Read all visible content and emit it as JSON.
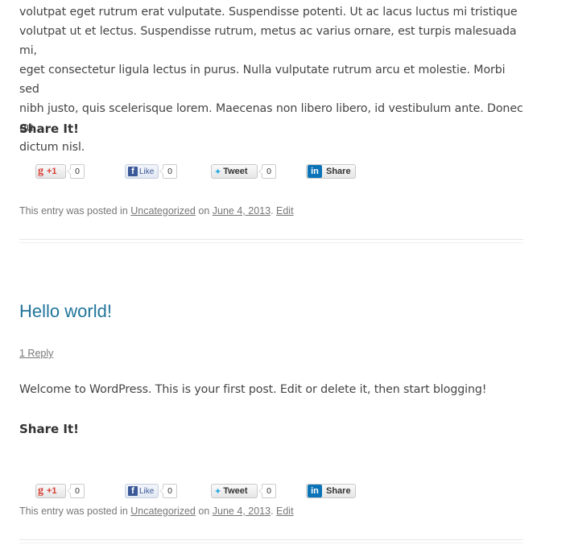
{
  "post1": {
    "body_lines": [
      "volutpat eget rutrum erat vulputate. Suspendisse potenti. Ut ac lacus luctus mi tristique",
      "volutpat ut et lectus. Suspendisse rutrum, metus ac varius ornare, est turpis malesuada mi,",
      "eget consectetur ligula lectus in purus. Nulla vulputate rutrum arcu et molestie. Morbi sed",
      "nibh justo, quis scelerisque lorem. Maecenas non libero libero, id vestibulum ante. Donec eu",
      "dictum nisl."
    ],
    "share_title": "Share It!",
    "share": {
      "gplus_label": "+1",
      "gplus_count": "0",
      "fb_label": "Like",
      "fb_count": "0",
      "tw_label": "Tweet",
      "tw_count": "0",
      "li_label": "Share"
    },
    "meta": {
      "prefix": "This entry was posted in",
      "category": "Uncategorized",
      "on": "on",
      "date": "June 4, 2013",
      "edit": "Edit"
    }
  },
  "post2": {
    "title": "Hello world!",
    "reply": "1 Reply",
    "body": "Welcome to WordPress. This is your first post. Edit or delete it, then start blogging!",
    "share_title": "Share It!",
    "share": {
      "gplus_label": "+1",
      "gplus_count": "0",
      "fb_label": "Like",
      "fb_count": "0",
      "tw_label": "Tweet",
      "tw_count": "0",
      "li_label": "Share"
    },
    "meta": {
      "prefix": "This entry was posted in",
      "category": "Uncategorized",
      "on": "on",
      "date": "June 4, 2013",
      "edit": "Edit"
    }
  }
}
